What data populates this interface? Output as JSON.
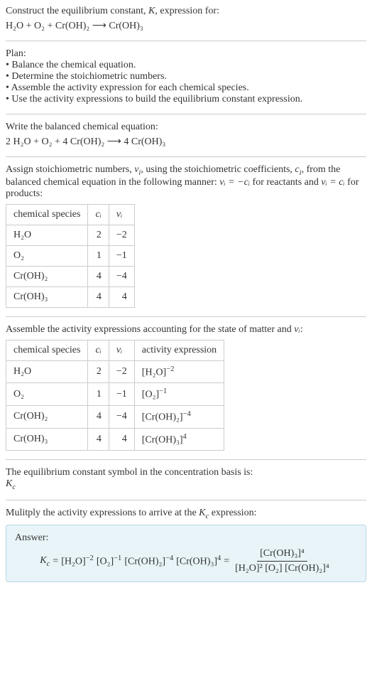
{
  "header": {
    "line1_prefix": "Construct the equilibrium constant, ",
    "line1_K": "K",
    "line1_suffix": ", expression for:",
    "equation": "H₂O + O₂ + Cr(OH)₂  ⟶  Cr(OH)₃"
  },
  "plan": {
    "title": "Plan:",
    "items": [
      "Balance the chemical equation.",
      "Determine the stoichiometric numbers.",
      "Assemble the activity expression for each chemical species.",
      "Use the activity expressions to build the equilibrium constant expression."
    ]
  },
  "balanced": {
    "title": "Write the balanced chemical equation:",
    "equation": "2 H₂O + O₂ + 4 Cr(OH)₂  ⟶  4 Cr(OH)₃"
  },
  "stoich": {
    "intro_1": "Assign stoichiometric numbers, ",
    "nu": "ν",
    "sub_i": "i",
    "intro_2": ", using the stoichiometric coefficients, ",
    "c": "c",
    "intro_3": ", from the balanced chemical equation in the following manner: ",
    "rel1": "νᵢ = −cᵢ",
    "intro_4": " for reactants and ",
    "rel2": "νᵢ = cᵢ",
    "intro_5": " for products:",
    "headers": [
      "chemical species",
      "cᵢ",
      "νᵢ"
    ],
    "rows": [
      [
        "H₂O",
        "2",
        "−2"
      ],
      [
        "O₂",
        "1",
        "−1"
      ],
      [
        "Cr(OH)₂",
        "4",
        "−4"
      ],
      [
        "Cr(OH)₃",
        "4",
        "4"
      ]
    ]
  },
  "activity": {
    "intro_1": "Assemble the activity expressions accounting for the state of matter and ",
    "nu": "νᵢ",
    "intro_2": ":",
    "headers": [
      "chemical species",
      "cᵢ",
      "νᵢ",
      "activity expression"
    ],
    "rows": [
      {
        "species": "H₂O",
        "c": "2",
        "nu": "−2",
        "expr_base": "[H₂O]",
        "expr_exp": "−2"
      },
      {
        "species": "O₂",
        "c": "1",
        "nu": "−1",
        "expr_base": "[O₂]",
        "expr_exp": "−1"
      },
      {
        "species": "Cr(OH)₂",
        "c": "4",
        "nu": "−4",
        "expr_base": "[Cr(OH)₂]",
        "expr_exp": "−4"
      },
      {
        "species": "Cr(OH)₃",
        "c": "4",
        "nu": "4",
        "expr_base": "[Cr(OH)₃]",
        "expr_exp": "4"
      }
    ]
  },
  "symbol": {
    "line": "The equilibrium constant symbol in the concentration basis is:",
    "kc_base": "K",
    "kc_sub": "c"
  },
  "multiply": {
    "line_1": "Mulitply the activity expressions to arrive at the ",
    "kc": "K",
    "kc_sub": "c",
    "line_2": " expression:"
  },
  "answer": {
    "label": "Answer:",
    "kc": "Kc",
    "eq": " = ",
    "terms": [
      {
        "base": "[H₂O]",
        "exp": "−2"
      },
      {
        "base": "[O₂]",
        "exp": "−1"
      },
      {
        "base": "[Cr(OH)₂]",
        "exp": "−4"
      },
      {
        "base": "[Cr(OH)₃]",
        "exp": "4"
      }
    ],
    "frac_num": "[Cr(OH)₃]⁴",
    "frac_den": "[H₂O]² [O₂] [Cr(OH)₂]⁴"
  },
  "chart_data": {
    "type": "table",
    "tables": [
      {
        "name": "stoichiometric numbers",
        "columns": [
          "chemical species",
          "c_i",
          "nu_i"
        ],
        "rows": [
          [
            "H2O",
            2,
            -2
          ],
          [
            "O2",
            1,
            -1
          ],
          [
            "Cr(OH)2",
            4,
            -4
          ],
          [
            "Cr(OH)3",
            4,
            4
          ]
        ]
      },
      {
        "name": "activity expressions",
        "columns": [
          "chemical species",
          "c_i",
          "nu_i",
          "activity expression"
        ],
        "rows": [
          [
            "H2O",
            2,
            -2,
            "[H2O]^-2"
          ],
          [
            "O2",
            1,
            -1,
            "[O2]^-1"
          ],
          [
            "Cr(OH)2",
            4,
            -4,
            "[Cr(OH)2]^-4"
          ],
          [
            "Cr(OH)3",
            4,
            4,
            "[Cr(OH)3]^4"
          ]
        ]
      }
    ]
  }
}
